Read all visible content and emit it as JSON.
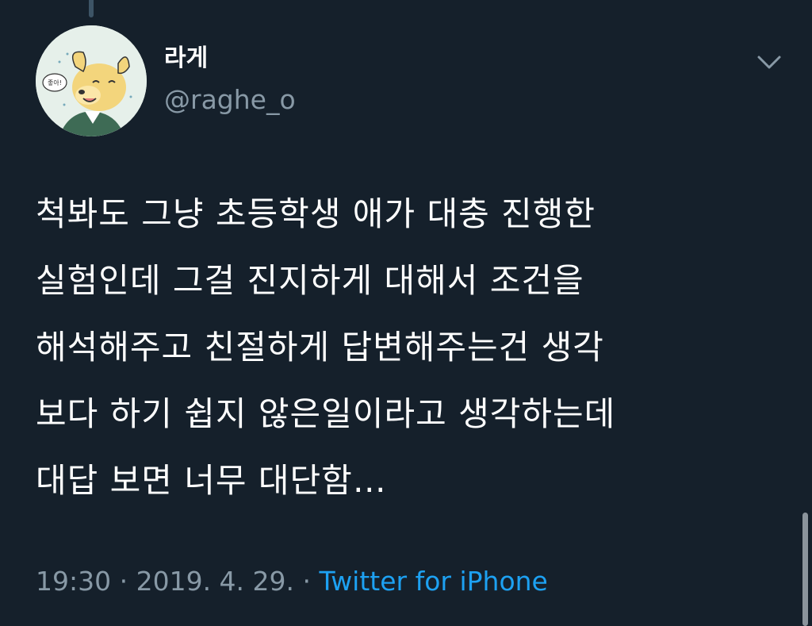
{
  "user": {
    "display_name": "라게",
    "handle": "@raghe_o",
    "avatar_speech": "좋아!"
  },
  "tweet": {
    "text": "척봐도 그냥 초등학생 애가 대충 진행한\n실험인데 그걸 진지하게 대해서 조건을\n해석해주고  친절하게 답변해주는건 생각\n보다 하기 쉽지 않은일이라고 생각하는데\n대답 보면 너무 대단함…"
  },
  "meta": {
    "time": "19:30",
    "separator1": " · ",
    "date": "2019. 4. 29.",
    "separator2": " · ",
    "source": "Twitter for iPhone"
  },
  "colors": {
    "background": "#15202b",
    "text_primary": "#ffffff",
    "text_secondary": "#8899a6",
    "accent": "#1da1f2"
  },
  "icons": {
    "menu": "chevron-down-icon"
  }
}
